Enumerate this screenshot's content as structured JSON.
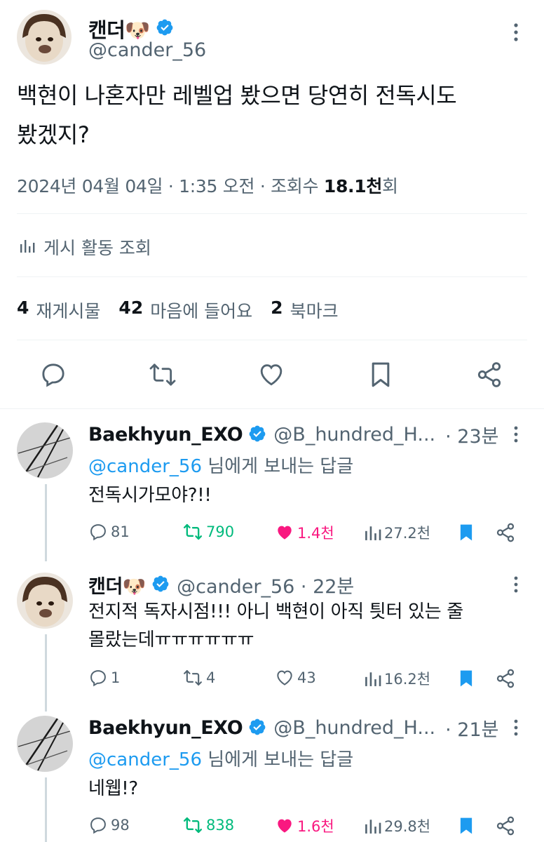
{
  "main": {
    "author_name": "캔더🐶",
    "author_handle": "@cander_56",
    "text_line1": "백현이 나혼자만 레벨업 봤으면 당연히 전독시도",
    "text_line2": "봤겠지?",
    "meta_prefix": "2024년 04월 04일 · 1:35 오전 · 조회수 ",
    "meta_views": "18.1천",
    "meta_suffix": "회",
    "analytics_label": "게시 활동 조회",
    "stats": {
      "reposts_num": "4",
      "reposts_label": "재게시물",
      "likes_num": "42",
      "likes_label": "마음에 들어요",
      "bookmarks_num": "2",
      "bookmarks_label": "북마크"
    }
  },
  "replies": [
    {
      "name": "Baekhyun_EXO",
      "handle": "@B_hundred_H...",
      "time": "· 23분",
      "reply_to_mention": "@cander_56",
      "reply_to_suffix": " 님에게 보내는 답글",
      "text": "전독시가모야?!!",
      "comments": "81",
      "reposts": "790",
      "likes": "1.4천",
      "views": "27.2천"
    },
    {
      "name": "캔더🐶",
      "handle": "@cander_56 · 22분",
      "text_line1": "전지적 독자시점!!! 아니 백현이 아직 틧터 있는 줄",
      "text_line2": "몰랐는데ㅠㅠㅠㅠㅠㅠ",
      "comments": "1",
      "reposts": "4",
      "likes": "43",
      "views": "16.2천"
    },
    {
      "name": "Baekhyun_EXO",
      "handle": "@B_hundred_H...",
      "time": "· 21분",
      "reply_to_mention": "@cander_56",
      "reply_to_suffix": " 님에게 보내는 답글",
      "text": "네웹!?",
      "comments": "98",
      "reposts": "838",
      "likes": "1.6천",
      "views": "29.8천"
    }
  ],
  "colors": {
    "verified": "#1d9bf0",
    "repost_active": "#00ba7c",
    "like_active": "#f91880",
    "bookmark_active": "#1d9bf0",
    "secondary": "#536471"
  }
}
